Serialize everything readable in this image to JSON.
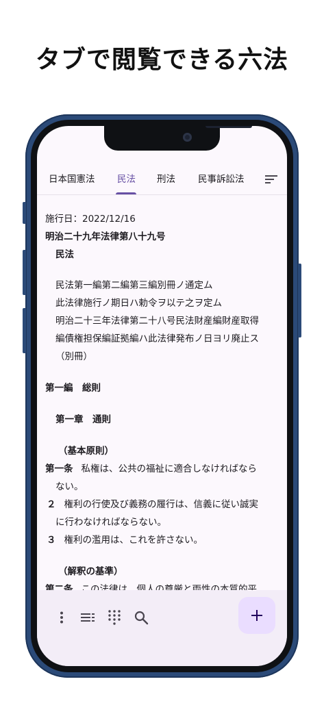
{
  "headline": "タブで閲覧できる六法",
  "tabs": [
    {
      "label": "日本国憲法",
      "active": false
    },
    {
      "label": "民法",
      "active": true
    },
    {
      "label": "刑法",
      "active": false
    },
    {
      "label": "民事訴訟法",
      "active": false
    }
  ],
  "icons": {
    "sort": "sort-icon",
    "more": "more-vert-icon",
    "list": "list-icon",
    "grid": "grid-icon",
    "search": "search-icon",
    "add": "plus-icon"
  },
  "colors": {
    "accent": "#6750a4",
    "fab": "#eaddff",
    "bottom_bar": "#f3edf7",
    "screen": "#fcf8fd"
  },
  "document": {
    "enforcement_date": "施行日：2022/12/16",
    "law_number": "明治二十九年法律第八十九号",
    "law_name": "民法",
    "preamble": [
      "民法第一編第二編第三編別冊ノ通定ム",
      "此法律施行ノ期日ハ勅令ヲ以テ之ヲ定ム",
      "明治二十三年法律第二十八号民法財産編財産取得",
      "編債権担保編証拠編ハ此法律発布ノ日ヨリ廃止ス",
      "（別冊）"
    ],
    "part": "第一編　総則",
    "chapter": "第一章　通則",
    "heading1": "（基本原則）",
    "article1_num": "第一条",
    "article1_text_a": "私権は、公共の福祉に適合しなければなら",
    "article1_text_b": "ない。",
    "para2_num": "２",
    "para2_text_a": "権利の行使及び義務の履行は、信義に従い誠実",
    "para2_text_b": "に行わなければならない。",
    "para3_num": "３",
    "para3_text": "権利の濫用は、これを許さない。",
    "heading2": "（解釈の基準）",
    "article2_num": "第二条",
    "article2_text": "この法律は、個人の尊厳と両性の本質的平"
  }
}
